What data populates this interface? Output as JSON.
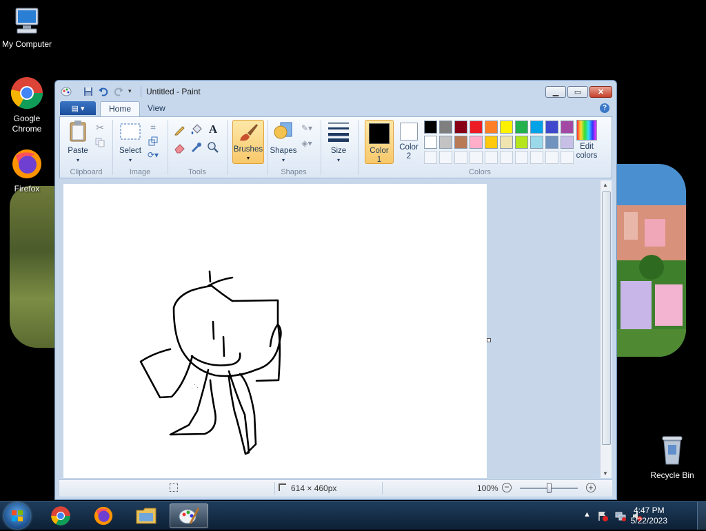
{
  "desktop": {
    "icons": [
      {
        "label": "My Computer"
      },
      {
        "label": "Google Chrome"
      },
      {
        "label": "Firefox"
      },
      {
        "label": "Recycle Bin"
      }
    ]
  },
  "window": {
    "title": "Untitled - Paint",
    "tabs": [
      "Home",
      "View"
    ],
    "active_tab": "Home",
    "ribbon": {
      "clipboard": {
        "paste": "Paste",
        "group": "Clipboard"
      },
      "image": {
        "select": "Select",
        "group": "Image"
      },
      "tools": {
        "group": "Tools"
      },
      "brushes": {
        "label": "Brushes"
      },
      "shapes": {
        "label": "Shapes",
        "group": "Shapes"
      },
      "size": {
        "label": "Size"
      },
      "colors": {
        "color1_a": "Color",
        "color1_b": "1",
        "color2_a": "Color",
        "color2_b": "2",
        "edit_a": "Edit",
        "edit_b": "colors",
        "group": "Colors",
        "row1": [
          "#000000",
          "#7f7f7f",
          "#880015",
          "#ed1c24",
          "#ff7f27",
          "#fff200",
          "#22b14c",
          "#00a2e8",
          "#3f48cc",
          "#a349a4"
        ],
        "row2": [
          "#ffffff",
          "#c3c3c3",
          "#b97a57",
          "#ffaec9",
          "#ffc90e",
          "#efe4b0",
          "#b5e61d",
          "#99d9ea",
          "#7092be",
          "#c8bfe7"
        ],
        "primary": "#000000",
        "secondary": "#ffffff"
      }
    },
    "status": {
      "dimensions": "614 × 460px",
      "zoom": "100%",
      "zoom_level": 0.5
    }
  },
  "taskbar": {
    "time": "4:47 PM",
    "date": "5/22/2023"
  }
}
